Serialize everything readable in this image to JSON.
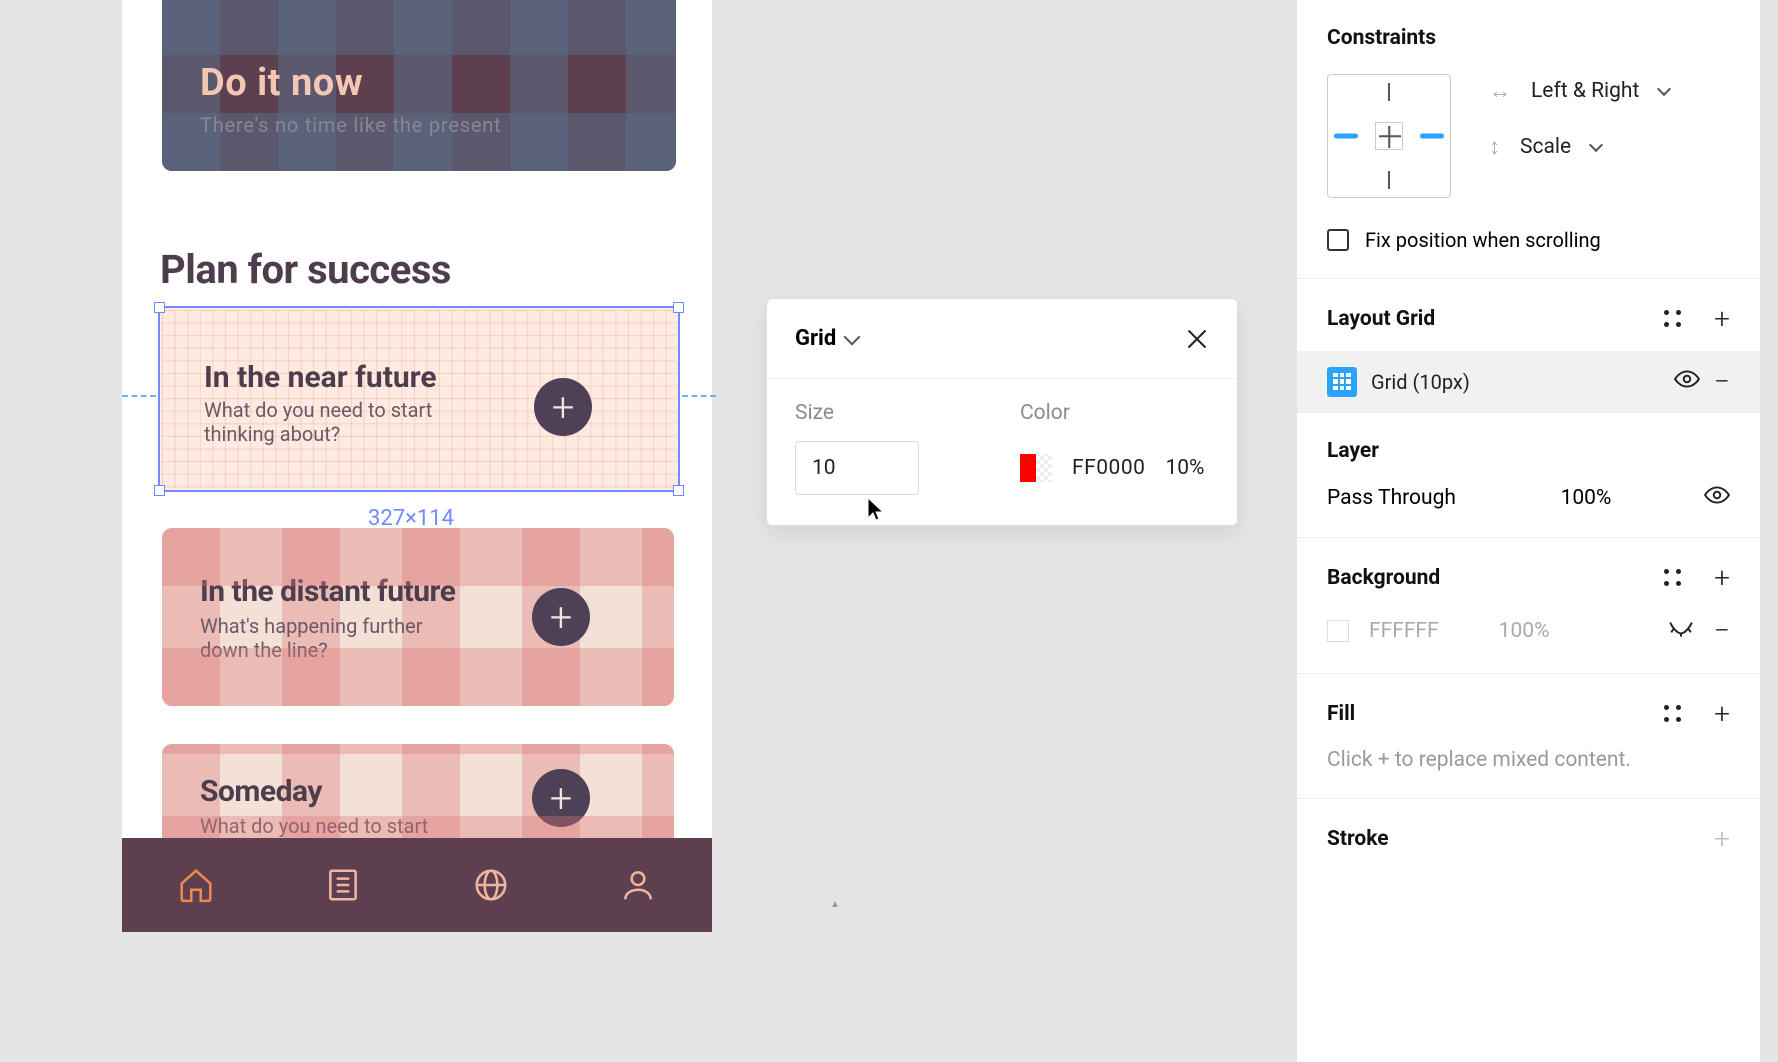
{
  "canvas": {
    "hero": {
      "title": "Do it now",
      "subtitle": "There's no time like the present"
    },
    "section_title": "Plan for success",
    "cards": [
      {
        "title": "In the near future",
        "subtitle": "What do you need to start thinking about?"
      },
      {
        "title": "In the distant future",
        "subtitle": "What's happening further down the line?"
      },
      {
        "title": "Someday",
        "subtitle": "What do you need to start"
      }
    ],
    "selection_dimensions": "327×114"
  },
  "popover": {
    "title": "Grid",
    "size_label": "Size",
    "size_value": "10",
    "color_label": "Color",
    "color_hex": "FF0000",
    "color_opacity": "10%"
  },
  "inspector": {
    "constraints": {
      "title": "Constraints",
      "horizontal": "Left & Right",
      "vertical": "Scale",
      "fix_position": "Fix position when scrolling"
    },
    "layout_grid": {
      "title": "Layout Grid",
      "item_label": "Grid (10px)"
    },
    "layer": {
      "title": "Layer",
      "blend_mode": "Pass Through",
      "opacity": "100%"
    },
    "background": {
      "title": "Background",
      "hex": "FFFFFF",
      "opacity": "100%"
    },
    "fill": {
      "title": "Fill",
      "hint": "Click + to replace mixed content."
    },
    "stroke": {
      "title": "Stroke"
    }
  }
}
